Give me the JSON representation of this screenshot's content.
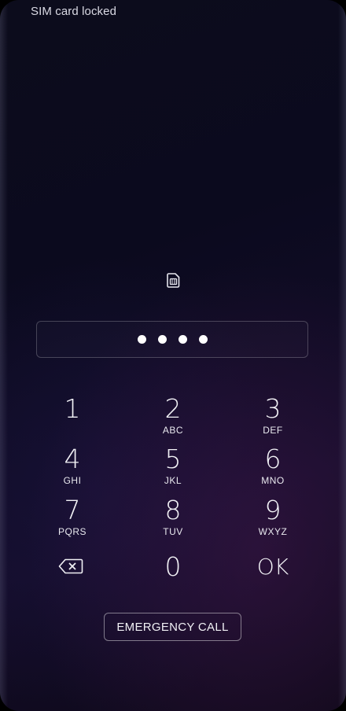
{
  "status_bar": {
    "text": "SIM card locked"
  },
  "sim_icon": {
    "icon": "sim-card-icon"
  },
  "pin_field": {
    "entered_digits": 4
  },
  "keypad": {
    "keys": [
      {
        "num": "1",
        "letters": ""
      },
      {
        "num": "2",
        "letters": "ABC"
      },
      {
        "num": "3",
        "letters": "DEF"
      },
      {
        "num": "4",
        "letters": "GHI"
      },
      {
        "num": "5",
        "letters": "JKL"
      },
      {
        "num": "6",
        "letters": "MNO"
      },
      {
        "num": "7",
        "letters": "PQRS"
      },
      {
        "num": "8",
        "letters": "TUV"
      },
      {
        "num": "9",
        "letters": "WXYZ"
      }
    ],
    "zero": "0",
    "ok": "OK",
    "backspace_icon": "backspace-icon"
  },
  "emergency_call": {
    "label": "EMERGENCY CALL"
  },
  "colors": {
    "background": "#0c0b1e",
    "accent_purple": "#3e1648",
    "text": "#ffffff"
  }
}
